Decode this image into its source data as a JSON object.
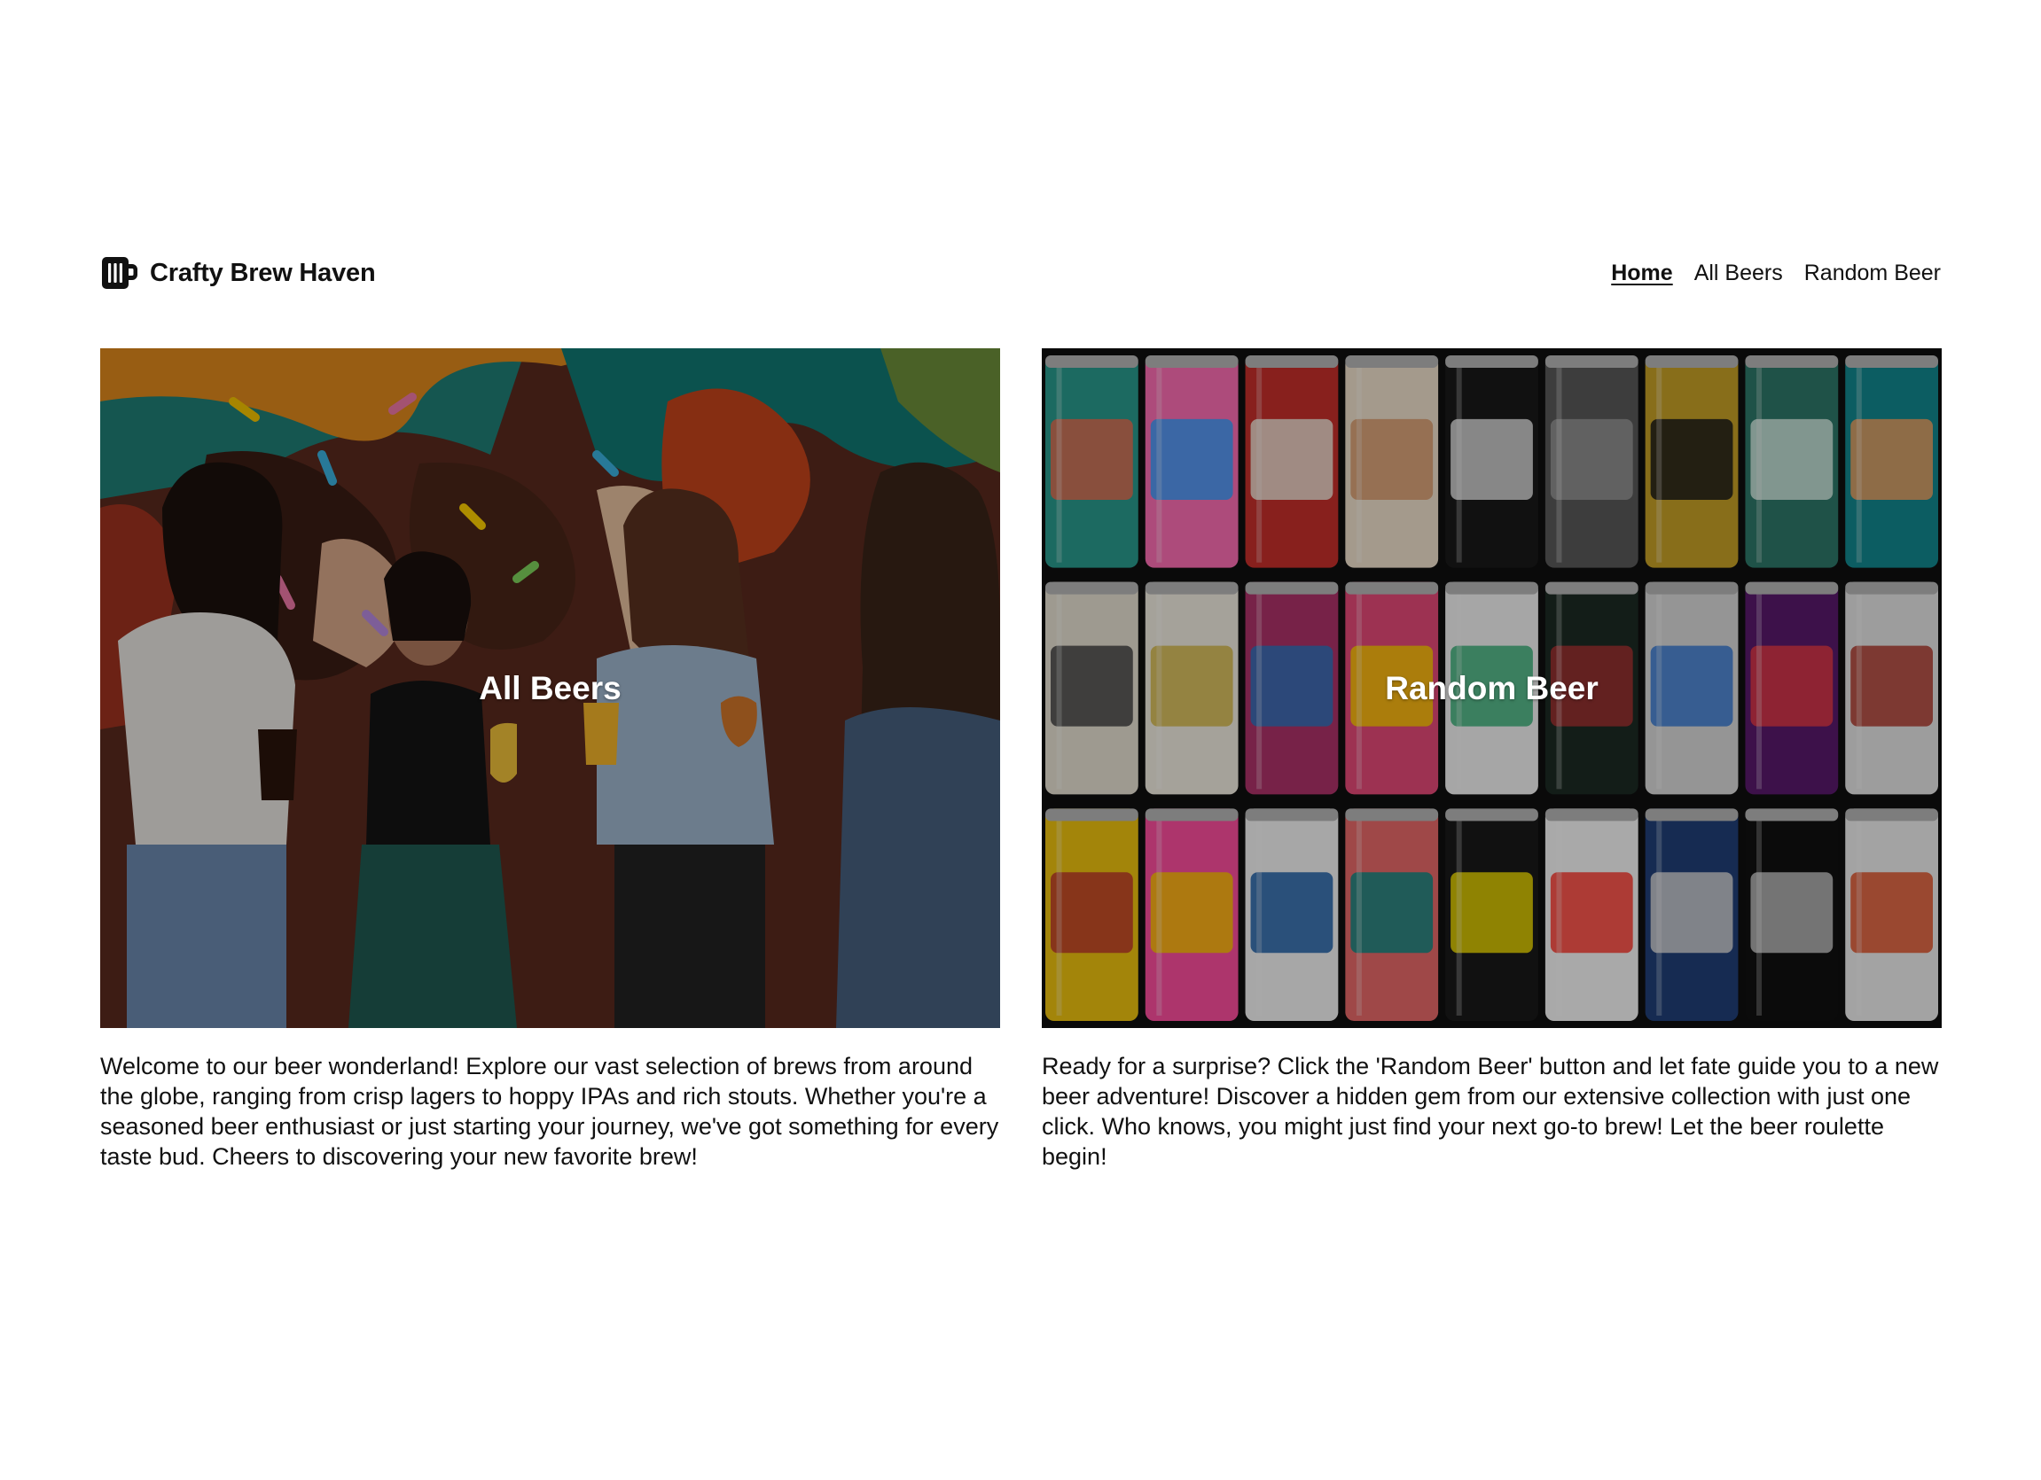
{
  "brand": {
    "name": "Crafty Brew Haven",
    "logo_icon": "beer-mug-icon"
  },
  "nav": {
    "items": [
      {
        "label": "Home",
        "active": true
      },
      {
        "label": "All Beers",
        "active": false
      },
      {
        "label": "Random Beer",
        "active": false
      }
    ]
  },
  "cards": [
    {
      "title": "All Beers",
      "image": "friends-drinking-beer-in-front-of-mural",
      "description": "Welcome to our beer wonderland! Explore our vast selection of brews from around the globe, ranging from crisp lagers to hoppy IPAs and rich stouts. Whether you're a seasoned beer enthusiast or just starting your journey, we've got something for every taste bud. Cheers to discovering your new favorite brew!"
    },
    {
      "title": "Random Beer",
      "image": "wall-of-colorful-beer-cans",
      "description": "Ready for a surprise? Click the 'Random Beer' button and let fate guide you to a new beer adventure! Discover a hidden gem from our extensive collection with just one click. Who knows, you might just find your next go-to brew! Let the beer roulette begin!"
    }
  ]
}
